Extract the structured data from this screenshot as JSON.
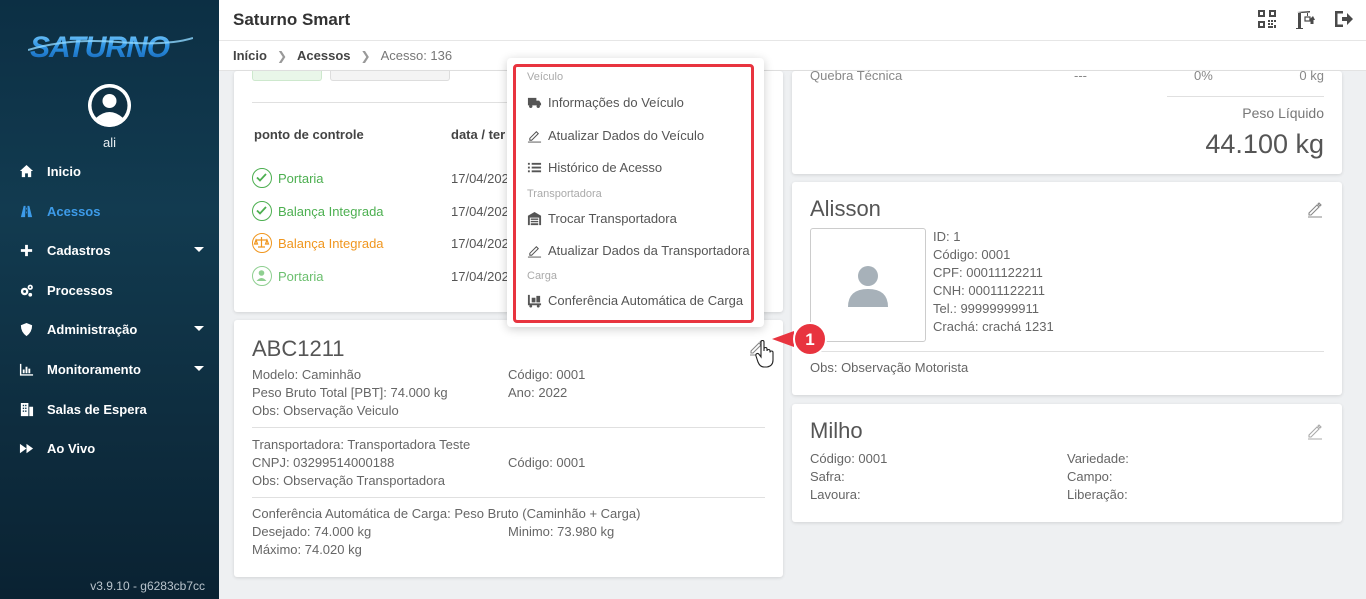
{
  "app": {
    "title": "Saturno Smart",
    "logo_text": "SATURNO",
    "version": "v3.9.10 - g6283cb7cc"
  },
  "user": {
    "name": "ali"
  },
  "sidebar": {
    "items": [
      {
        "label": "Inicio",
        "icon": "home-icon",
        "active": false,
        "caret": false
      },
      {
        "label": "Acessos",
        "icon": "road-icon",
        "active": true,
        "caret": false
      },
      {
        "label": "Cadastros",
        "icon": "plus-icon",
        "active": false,
        "caret": true
      },
      {
        "label": "Processos",
        "icon": "gears-icon",
        "active": false,
        "caret": false
      },
      {
        "label": "Administração",
        "icon": "shield-icon",
        "active": false,
        "caret": true
      },
      {
        "label": "Monitoramento",
        "icon": "chart-icon",
        "active": false,
        "caret": true
      },
      {
        "label": "Salas de Espera",
        "icon": "building-icon",
        "active": false,
        "caret": false
      },
      {
        "label": "Ao Vivo",
        "icon": "fast-forward-icon",
        "active": false,
        "caret": false
      }
    ]
  },
  "breadcrumb": {
    "home": "Início",
    "section": "Acessos",
    "current": "Acesso: 136"
  },
  "control_points": {
    "headers": {
      "point": "ponto de controle",
      "date": "data / ter"
    },
    "rows": [
      {
        "name": "Portaria",
        "date": "17/04/202",
        "status": "done",
        "color": "#4caf50"
      },
      {
        "name": "Balança Integrada",
        "date": "17/04/202",
        "status": "done",
        "color": "#4caf50"
      },
      {
        "name": "Balança Integrada",
        "date": "17/04/202",
        "status": "scale",
        "color": "#f0961e"
      },
      {
        "name": "Portaria",
        "date": "17/04/202",
        "status": "person",
        "color": "#6bbf6e"
      }
    ]
  },
  "vehicle": {
    "plate": "ABC1211",
    "model": "Modelo: Caminhão",
    "pbt": "Peso Bruto Total [PBT]: 74.000 kg",
    "obs": "Obs: Observação Veiculo",
    "code": "Código: 0001",
    "year": "Ano: 2022",
    "carrier": "Transportadora: Transportadora Teste",
    "cnpj": "CNPJ: 03299514000188",
    "carrier_code": "Código: 0001",
    "carrier_obs": "Obs: Observação Transportadora",
    "check_title": "Conferência Automática de Carga: Peso Bruto (Caminhão + Carga)",
    "desired": "Desejado: 74.000 kg",
    "minimum": "Minimo: 73.980 kg",
    "maximum": "Máximo: 74.020 kg"
  },
  "weights": {
    "row_label": "Quebra Técnica",
    "row_value": "---",
    "row_percent": "0%",
    "row_kg": "0 kg",
    "net_label": "Peso Líquido",
    "net_value": "44.100 kg"
  },
  "driver": {
    "name": "Alisson",
    "id": "ID: 1",
    "code": "Código: 0001",
    "cpf": "CPF: 00011122211",
    "cnh": "CNH: 00011122211",
    "phone": "Tel.: 99999999911",
    "badge": "Crachá: crachá 1231",
    "obs": "Obs: Observação Motorista"
  },
  "product": {
    "name": "Milho",
    "code": "Código: 0001",
    "harvest": "Safra:",
    "crop": "Lavoura:",
    "variety": "Variedade:",
    "field": "Campo:",
    "release": "Liberação:"
  },
  "dropdown_menu": {
    "section_vehicle": "Veículo",
    "item_info": "Informações do Veículo",
    "item_update_vehicle": "Atualizar Dados do Veículo",
    "item_history": "Histórico de Acesso",
    "section_carrier": "Transportadora",
    "item_change_carrier": "Trocar Transportadora",
    "item_update_carrier": "Atualizar Dados da Transportadora",
    "section_cargo": "Carga",
    "item_cargo_check": "Conferência Automática de Carga"
  },
  "callout": {
    "number": "1",
    "color": "#e8343f"
  },
  "colors": {
    "accent": "#3d9be9",
    "highlight": "#e8343f",
    "success": "#4caf50",
    "warning": "#f0961e"
  }
}
